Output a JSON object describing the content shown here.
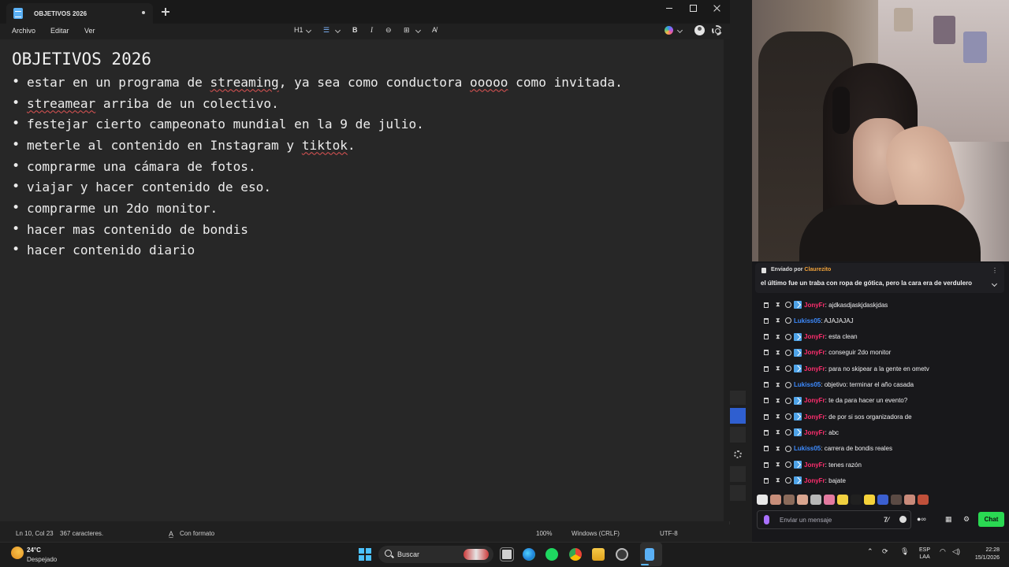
{
  "notepad": {
    "tab_title": "OBJETIVOS 2026",
    "menu": [
      "Archivo",
      "Editar",
      "Ver"
    ],
    "toolbar": {
      "heading": "H1",
      "bold": "B",
      "italic": "I",
      "link": "⊖",
      "table": "⊞",
      "clear": "A̸"
    },
    "content": {
      "heading": "OBJETIVOS 2026",
      "items": [
        "estar en un programa de streaming, ya sea como conductora ooooo como invitada.",
        "streamear arriba de un colectivo.",
        "festejar cierto campeonato mundial en la 9 de julio.",
        "meterle al contenido en Instagram y tiktok.",
        "comprarme una cámara de fotos.",
        "viajar y hacer contenido de eso.",
        "comprarme un 2do monitor.",
        "hacer mas contenido de bondis",
        "hacer contenido diario"
      ]
    },
    "status": {
      "position": "Ln 10, Col 23",
      "chars": "367 caracteres.",
      "format": "Con formato",
      "zoom": "100%",
      "line_ending": "Windows (CRLF)",
      "encoding": "UTF-8"
    }
  },
  "chat": {
    "pinned": {
      "label": "Enviado por",
      "user": "Claurezito",
      "message": "el último fue un traba con ropa de gótica, pero la cara era de verdulero"
    },
    "messages": [
      {
        "user": "JonyFr",
        "text": ": ajdkasdjaskjdaskjdas",
        "color": "#ff2e6e",
        "sub": true
      },
      {
        "user": "Lukiss05",
        "text": ": AJAJAJAJ",
        "color": "#3d8bff",
        "sub": false
      },
      {
        "user": "JonyFr",
        "text": ": esta clean",
        "color": "#ff2e6e",
        "sub": true
      },
      {
        "user": "JonyFr",
        "text": ": conseguir 2do monitor",
        "color": "#ff2e6e",
        "sub": true
      },
      {
        "user": "JonyFr",
        "text": ": para no skipear a la gente en ometv",
        "color": "#ff2e6e",
        "sub": true
      },
      {
        "user": "Lukiss05",
        "text": ": objetivo: terminar el año casada",
        "color": "#3d8bff",
        "sub": false
      },
      {
        "user": "JonyFr",
        "text": ": te da para hacer un evento?",
        "color": "#ff2e6e",
        "sub": true
      },
      {
        "user": "JonyFr",
        "text": ": de por si sos organizadora de",
        "color": "#ff2e6e",
        "sub": true
      },
      {
        "user": "JonyFr",
        "text": ": abc",
        "color": "#ff2e6e",
        "sub": true
      },
      {
        "user": "Lukiss05",
        "text": ": carrera de bondis reales",
        "color": "#3d8bff",
        "sub": false
      },
      {
        "user": "JonyFr",
        "text": ": tenes razón",
        "color": "#ff2e6e",
        "sub": true
      },
      {
        "user": "JonyFr",
        "text": ": bajate",
        "color": "#ff2e6e",
        "sub": true
      }
    ],
    "input_placeholder": "Enviar un mensaje",
    "chat_button": "Chat"
  },
  "taskbar": {
    "temperature": "24°C",
    "weather": "Despejado",
    "search": "Buscar",
    "lang_top": "ESP",
    "lang_bottom": "LAA",
    "time": "22:28",
    "date": "15/1/2026"
  },
  "colors": {
    "accent": "#4cc2ff",
    "chat_button": "#2ad852",
    "spell_error": "#e05454"
  }
}
